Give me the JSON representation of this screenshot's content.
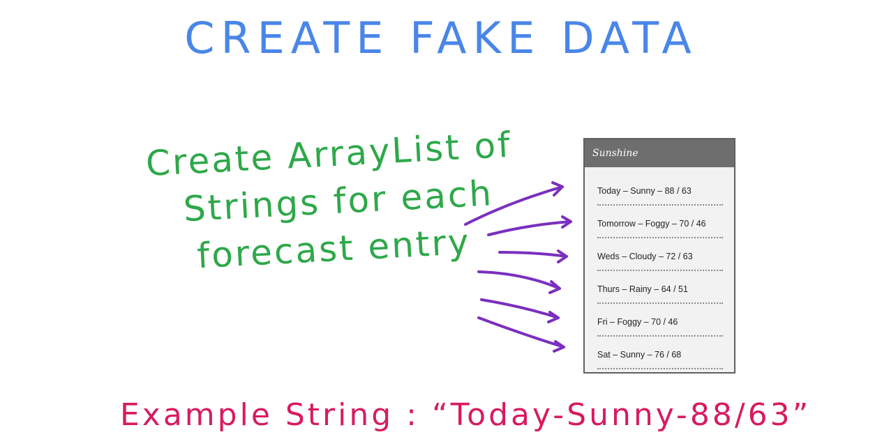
{
  "title": "CREATE FAKE DATA",
  "note": {
    "line1": "Create ArrayList of",
    "line2": "Strings for each",
    "line3": "forecast entry"
  },
  "colors": {
    "title": "#4a86e8",
    "note": "#2ea84a",
    "arrows": "#7b2fbf",
    "example": "#d81b60",
    "app_bar": "#6e6e6e",
    "list_bg": "#f2f2f2"
  },
  "phone": {
    "app_title": "Sunshine",
    "items": [
      {
        "label": "Today – Sunny – 88 / 63"
      },
      {
        "label": "Tomorrow – Foggy – 70 / 46"
      },
      {
        "label": "Weds – Cloudy – 72 / 63"
      },
      {
        "label": "Thurs – Rainy – 64 / 51"
      },
      {
        "label": "Fri – Foggy – 70 / 46"
      },
      {
        "label": "Sat – Sunny – 76 / 68"
      }
    ]
  },
  "example": {
    "text": "Example String : “Today-Sunny-88/63”"
  }
}
